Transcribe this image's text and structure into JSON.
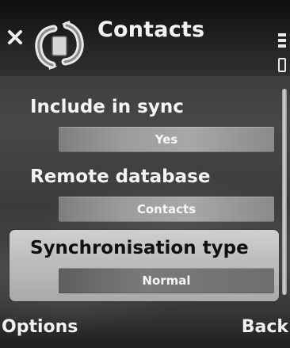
{
  "header": {
    "title": "Contacts",
    "close_icon": "close-icon",
    "app_icon": "sync-icon",
    "status_icon": "signal-icon"
  },
  "settings": [
    {
      "label": "Include in sync",
      "value": "Yes"
    },
    {
      "label": "Remote database",
      "value": "Contacts"
    },
    {
      "label": "Synchronisation type",
      "value": "Normal",
      "selected": true
    }
  ],
  "softkeys": {
    "left": "Options",
    "right": "Back"
  },
  "colors": {
    "highlight": "#c4c4c4",
    "text": "#f4f4f4"
  }
}
